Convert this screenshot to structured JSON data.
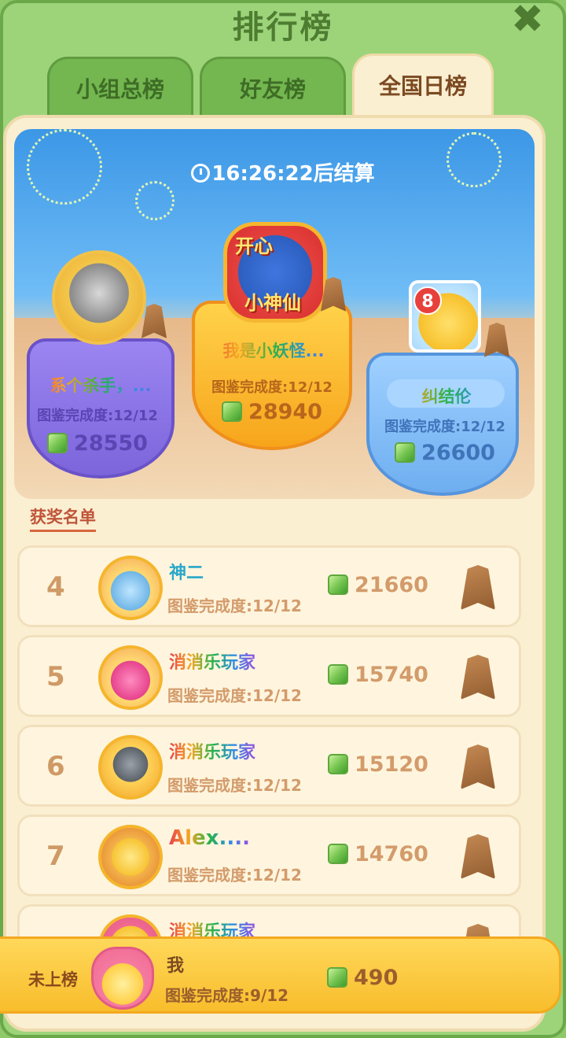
{
  "header": {
    "title": "排行榜"
  },
  "tabs": [
    {
      "label": "小组总榜"
    },
    {
      "label": "好友榜"
    },
    {
      "label": "全国日榜"
    }
  ],
  "banner": {
    "timer": "16:26:22后结算"
  },
  "podium": {
    "first": {
      "name": "我是小妖怪...",
      "completion": "图鉴完成度:12/12",
      "score": "28940"
    },
    "second": {
      "name": "系个杀手，...",
      "completion": "图鉴完成度:12/12",
      "score": "28550"
    },
    "third": {
      "name": "纠结伦",
      "completion": "图鉴完成度:12/12",
      "score": "26600"
    },
    "badge_line1": "开心",
    "badge_line2": "小神仙",
    "third_avatar_number": "8"
  },
  "section_label": "获奖名单",
  "rows": [
    {
      "rank": "4",
      "name": "神二",
      "completion": "图鉴完成度:12/12",
      "score": "21660"
    },
    {
      "rank": "5",
      "name": "消消乐玩家",
      "completion": "图鉴完成度:12/12",
      "score": "15740"
    },
    {
      "rank": "6",
      "name": "消消乐玩家",
      "completion": "图鉴完成度:12/12",
      "score": "15120"
    },
    {
      "rank": "7",
      "name": "Alex....",
      "completion": "图鉴完成度:12/12",
      "score": "14760"
    },
    {
      "rank": "",
      "name": "消消乐玩家",
      "completion": "",
      "score": ""
    }
  ],
  "me": {
    "status": "未上榜",
    "name": "我",
    "completion": "图鉴完成度:9/12",
    "score": "490"
  },
  "colors": {
    "frame_green": "#9dd47a",
    "panel_cream": "#fbefd2",
    "gold": "#f8bd2c"
  },
  "icons": [
    "close-icon",
    "clock-icon",
    "gem-icon",
    "bear-badge-icon"
  ]
}
